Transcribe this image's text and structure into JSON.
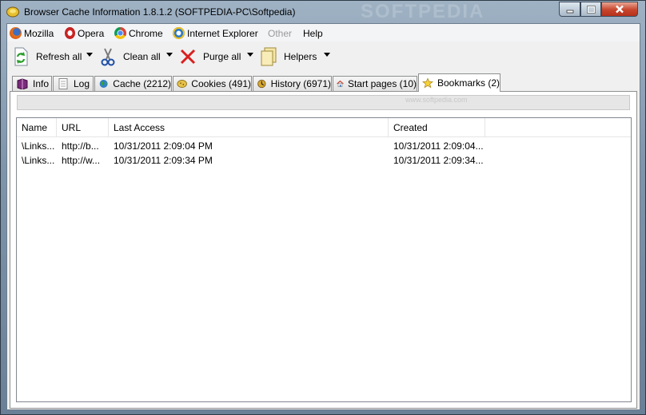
{
  "window": {
    "title": "Browser Cache Information 1.8.1.2 (SOFTPEDIA-PC\\Softpedia)",
    "watermark": "SOFTPEDIA"
  },
  "menu": {
    "items": [
      {
        "label": "Mozilla",
        "icon": "firefox-icon"
      },
      {
        "label": "Opera",
        "icon": "opera-icon"
      },
      {
        "label": "Chrome",
        "icon": "chrome-icon"
      },
      {
        "label": "Internet Explorer",
        "icon": "ie-icon"
      },
      {
        "label": "Other",
        "disabled": true
      },
      {
        "label": "Help"
      }
    ]
  },
  "toolbar": {
    "refresh_label": "Refresh all",
    "clean_label": "Clean all",
    "purge_label": "Purge all",
    "helpers_label": "Helpers"
  },
  "tabs": [
    {
      "label": "Info",
      "icon": "book-icon"
    },
    {
      "label": "Log",
      "icon": "document-icon"
    },
    {
      "label": "Cache (2212)",
      "icon": "globe-icon"
    },
    {
      "label": "Cookies (491)",
      "icon": "cookie-icon"
    },
    {
      "label": "History (6971)",
      "icon": "history-icon"
    },
    {
      "label": "Start pages (10)",
      "icon": "home-icon"
    },
    {
      "label": "Bookmarks (2)",
      "icon": "star-icon",
      "active": true
    }
  ],
  "panel": {
    "watermark": "www.softpedia.com"
  },
  "list": {
    "columns": [
      "Name",
      "URL",
      "Last Access",
      "Created"
    ],
    "rows": [
      [
        "\\Links...",
        "http://b...",
        "10/31/2011 2:09:04 PM",
        "10/31/2011 2:09:04..."
      ],
      [
        "\\Links...",
        "http://w...",
        "10/31/2011 2:09:34 PM",
        "10/31/2011 2:09:34..."
      ]
    ]
  }
}
